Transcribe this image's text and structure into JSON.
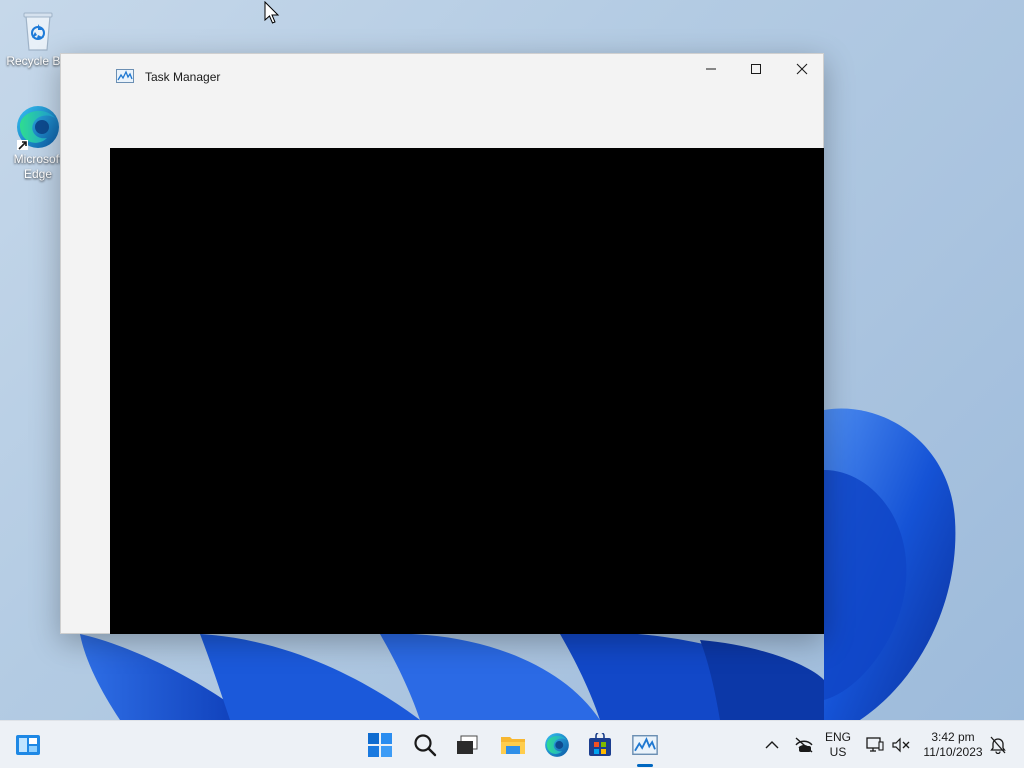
{
  "desktop": {
    "icons": [
      {
        "label": "Recycle Bin",
        "icon": "recycle-bin-icon"
      },
      {
        "label": "Microsoft\nEdge",
        "icon": "edge-icon"
      }
    ]
  },
  "window": {
    "title": "Task Manager",
    "app_icon": "task-manager-icon",
    "controls": {
      "minimize": "minimize-icon",
      "maximize": "maximize-icon",
      "close": "close-icon"
    }
  },
  "taskbar": {
    "widgets_icon": "widgets-icon",
    "apps": [
      {
        "name": "Start",
        "icon": "windows-start-icon"
      },
      {
        "name": "Search",
        "icon": "search-icon"
      },
      {
        "name": "Task View",
        "icon": "task-view-icon"
      },
      {
        "name": "File Explorer",
        "icon": "folder-icon"
      },
      {
        "name": "Microsoft Edge",
        "icon": "edge-icon"
      },
      {
        "name": "Microsoft Store",
        "icon": "store-icon"
      },
      {
        "name": "Task Manager",
        "icon": "task-manager-icon",
        "active": true
      }
    ],
    "tray": {
      "language_line1": "ENG",
      "language_line2": "US",
      "time": "3:42 pm",
      "date": "11/10/2023"
    }
  },
  "colors": {
    "accent": "#0067c0",
    "window_bg": "#f3f3f3",
    "content_bg": "#000000",
    "taskbar_bg": "#edf1f6"
  }
}
